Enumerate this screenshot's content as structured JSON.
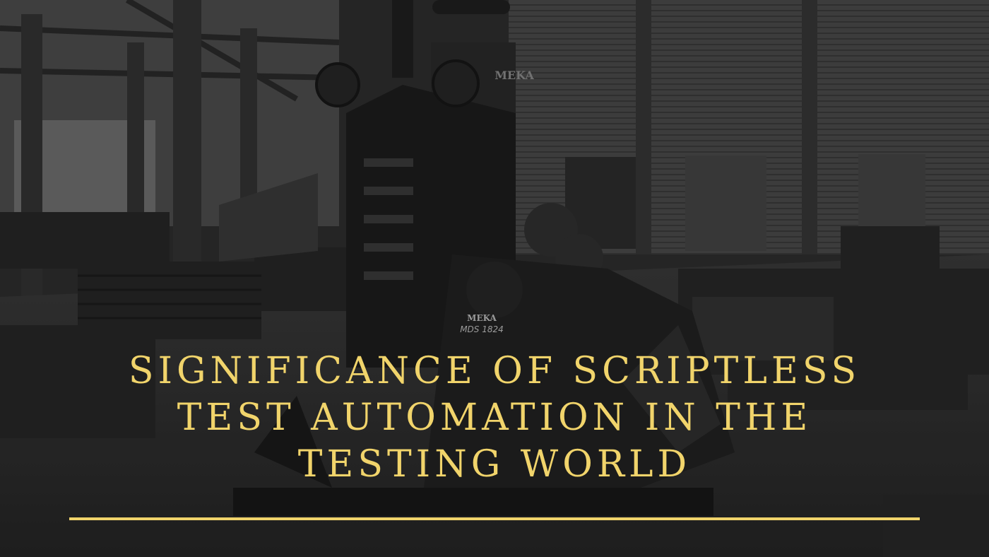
{
  "headline": {
    "line1": "SIGNIFICANCE OF SCRIPTLESS",
    "line2": "TEST AUTOMATION IN THE",
    "line3": "TESTING WORLD"
  },
  "machine_labels": {
    "brand_top": "MEKA",
    "brand_middle": "MEKA",
    "model": "MDS 1824"
  },
  "colors": {
    "headline_text": "#f1d46b",
    "underline": "#f1d46b",
    "background_tone": "#2b2b2b"
  }
}
